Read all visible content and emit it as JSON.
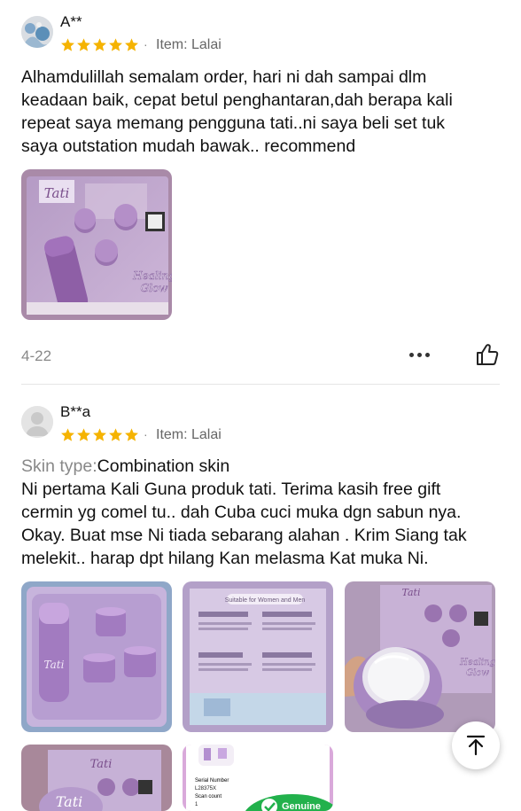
{
  "reviews": [
    {
      "username": "A**",
      "rating": 5,
      "item_prefix": "Item: Lalai",
      "text": "Alhamdulillah semalam order, hari ni dah sampai dlm\nkeadaan baik, cepat betul penghantaran,dah berapa kali\nrepeat saya memang pengguna tati..ni saya beli set tuk\nsaya outstation mudah bawak.. recommend",
      "photos": [
        "tati-set-box-photo"
      ],
      "photo_text": {
        "brand": "Tati",
        "badge": "Healing Glow"
      },
      "date": "4-22"
    },
    {
      "username": "B**a",
      "rating": 5,
      "item_prefix": "Item: Lalai",
      "skin_key": "Skin type:",
      "skin_value": "Combination skin",
      "text": "Ni pertama Kali Guna produk tati. Terima kasih free gift\ncermin yg comel tu.. dah Cuba cuci muka dgn sabun nya.\nOkay. Buat mse Ni tiada sebarang alahan . Krim Siang tak\nmelekit.. harap dpt hilang Kan melasma Kat muka Ni.",
      "photos": [
        "tati-set-tray-photo",
        "tati-box-back-photo",
        "tati-mirror-photo",
        "tati-box-front-photo",
        "genuine-check-photo"
      ],
      "photo_text": {
        "brand": "Tati",
        "badge": "Healing Glow",
        "box_header": "Suitable for Women and Men",
        "serial_label": "Serial Number",
        "serial_value": "L28375X",
        "scan_label": "Scan count",
        "scan_value": "1",
        "genuine_label": "Genuine"
      }
    }
  ],
  "colors": {
    "star": "#f5b301",
    "text": "#111111",
    "muted": "#888888",
    "divider": "#e6e6e6"
  },
  "icons": {
    "more": "ellipsis-icon",
    "like": "thumbs-up-icon",
    "scroll_top": "arrow-up-to-top-icon",
    "star": "star-icon"
  }
}
